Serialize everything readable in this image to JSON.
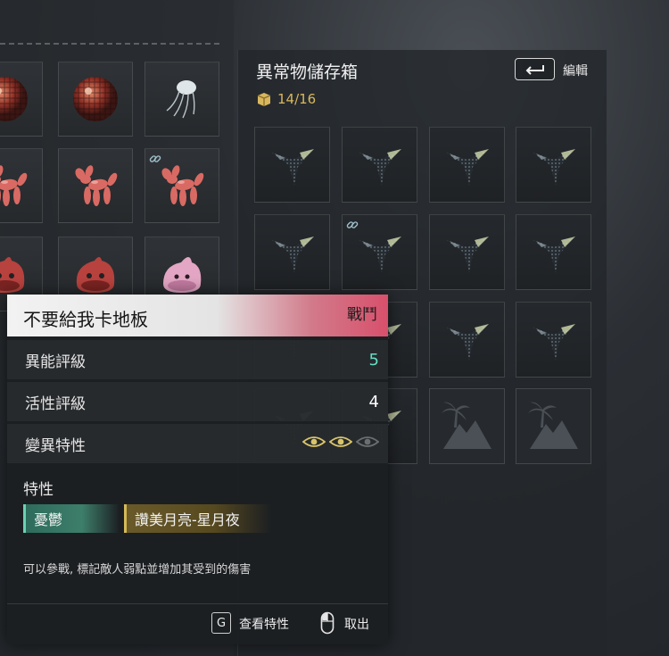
{
  "storage": {
    "title": "異常物儲存箱",
    "edit_label": "編輯",
    "capacity": "14/16",
    "slots": [
      {
        "item": "ray-item",
        "link": false
      },
      {
        "item": "ray-item",
        "link": false
      },
      {
        "item": "ray-item",
        "link": false
      },
      {
        "item": "ray-item",
        "link": false
      },
      {
        "item": "ray-item",
        "link": false
      },
      {
        "item": "ray-item",
        "link": true
      },
      {
        "item": "ray-item",
        "link": false
      },
      {
        "item": "ray-item",
        "link": false
      },
      {
        "item": "ray-item",
        "link": false
      },
      {
        "item": "ray-item",
        "link": false
      },
      {
        "item": "ray-item",
        "link": false
      },
      {
        "item": "ray-item",
        "link": false
      },
      {
        "item": "ray-item",
        "link": false
      },
      {
        "item": "ray-item",
        "link": false
      },
      {
        "item": "empty",
        "link": false
      },
      {
        "item": "empty",
        "link": false
      }
    ]
  },
  "inventory": {
    "rows": [
      [
        "disco-ball",
        "disco-ball",
        "jellyfish"
      ],
      [
        "balloon-dog",
        "balloon-dog",
        "balloon-dog"
      ],
      [
        "red-blob",
        "red-blob",
        "pink-blob"
      ]
    ]
  },
  "tooltip": {
    "name": "不要給我卡地板",
    "category": "戰鬥",
    "stats": [
      {
        "label": "異能評級",
        "value": "5",
        "color": "#63e0c3"
      },
      {
        "label": "活性評級",
        "value": "4",
        "color": "#ffffff"
      }
    ],
    "mutation_label": "變異特性",
    "mutation_eyes": {
      "filled": 2,
      "total": 3
    },
    "traits_title": "特性",
    "traits": [
      "憂鬱",
      "讚美月亮-星月夜"
    ],
    "description": "可以參戰, 標記敵人弱點並增加其受到的傷害",
    "footer": {
      "key_g": "G",
      "view_traits": "查看特性",
      "cancel": "取出"
    }
  }
}
